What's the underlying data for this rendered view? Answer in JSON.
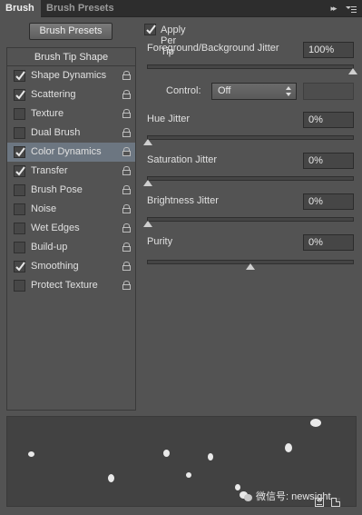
{
  "tabs": {
    "brush": "Brush",
    "brush_presets": "Brush Presets"
  },
  "header_icons": {
    "collapse": "collapse-panel-icon",
    "menu": "panel-menu-icon"
  },
  "preset_button": "Brush Presets",
  "list": {
    "heading": "Brush Tip Shape",
    "items": [
      {
        "label": "Shape Dynamics",
        "checked": true,
        "selected": false
      },
      {
        "label": "Scattering",
        "checked": true,
        "selected": false
      },
      {
        "label": "Texture",
        "checked": false,
        "selected": false
      },
      {
        "label": "Dual Brush",
        "checked": false,
        "selected": false
      },
      {
        "label": "Color Dynamics",
        "checked": true,
        "selected": true
      },
      {
        "label": "Transfer",
        "checked": true,
        "selected": false
      },
      {
        "label": "Brush Pose",
        "checked": false,
        "selected": false
      },
      {
        "label": "Noise",
        "checked": false,
        "selected": false
      },
      {
        "label": "Wet Edges",
        "checked": false,
        "selected": false
      },
      {
        "label": "Build-up",
        "checked": false,
        "selected": false
      },
      {
        "label": "Smoothing",
        "checked": true,
        "selected": false
      },
      {
        "label": "Protect Texture",
        "checked": false,
        "selected": false
      }
    ]
  },
  "settings": {
    "apply_per_tip": {
      "label": "Apply Per Tip",
      "checked": true
    },
    "fg_bg_jitter": {
      "label": "Foreground/Background Jitter",
      "value": "100%",
      "level": 1.0
    },
    "control": {
      "label": "Control:",
      "value": "Off"
    },
    "hue_jitter": {
      "label": "Hue Jitter",
      "value": "0%",
      "level": 0.0
    },
    "saturation_jitter": {
      "label": "Saturation Jitter",
      "value": "0%",
      "level": 0.0
    },
    "brightness_jitter": {
      "label": "Brightness Jitter",
      "value": "0%",
      "level": 0.0
    },
    "purity": {
      "label": "Purity",
      "value": "0%",
      "level": 0.5
    }
  },
  "watermark": "微信号: newsight",
  "colors": {
    "panel": "#535353",
    "selected_row": "#6c7681",
    "tabbar": "#2d2d2d"
  }
}
